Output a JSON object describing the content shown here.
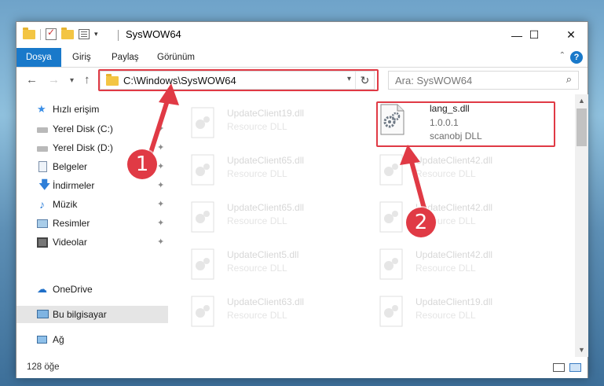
{
  "window": {
    "title": "SysWOW64",
    "controls": {
      "minimize": "—",
      "maximize": "☐",
      "close": "✕"
    }
  },
  "ribbon": {
    "tabs": [
      "Dosya",
      "Giriş",
      "Paylaş",
      "Görünüm"
    ],
    "help": "?",
    "collapse": "⌃"
  },
  "nav": {
    "back": "←",
    "forward": "→",
    "recent": "▾",
    "up": "↑",
    "address": "C:\\Windows\\SysWOW64",
    "address_dropdown": "▾",
    "refresh": "↻",
    "search_placeholder": "Ara: SysWOW64",
    "search_icon": "⌕"
  },
  "sidebar": {
    "quick_access": "Hızlı erişim",
    "items": [
      {
        "label": "Yerel Disk (C:)",
        "icon": "drive-icon",
        "pinned": true
      },
      {
        "label": "Yerel Disk (D:)",
        "icon": "drive-icon",
        "pinned": true
      },
      {
        "label": "Belgeler",
        "icon": "documents-icon",
        "pinned": true
      },
      {
        "label": "İndirmeler",
        "icon": "download-icon",
        "pinned": true
      },
      {
        "label": "Müzik",
        "icon": "music-icon",
        "pinned": true
      },
      {
        "label": "Resimler",
        "icon": "pictures-icon",
        "pinned": true
      },
      {
        "label": "Videolar",
        "icon": "video-icon",
        "pinned": true
      }
    ],
    "onedrive": "OneDrive",
    "this_pc": "Bu bilgisayar",
    "network": "Ağ",
    "pin_glyph": "📌"
  },
  "files": {
    "highlighted": {
      "name": "lang_s.dll",
      "version": "1.0.0.1",
      "description": "scanobj DLL"
    },
    "left_column": [
      {
        "name": "UpdateClient19.dll",
        "description": "Resource DLL"
      },
      {
        "name": "UpdateClient65.dll",
        "description": "Resource DLL"
      },
      {
        "name": "UpdateClient65.dll",
        "description": "Resource DLL"
      },
      {
        "name": "UpdateClient5.dll",
        "description": "Resource DLL"
      },
      {
        "name": "UpdateClient63.dll",
        "description": "Resource DLL"
      }
    ],
    "right_column": [
      {
        "name": "UpdateClient42.dll",
        "description": "Resource DLL"
      },
      {
        "name": "UpdateClient42.dll",
        "description": "Resource DLL"
      },
      {
        "name": "UpdateClient42.dll",
        "description": "Resource DLL"
      },
      {
        "name": "UpdateClient19.dll",
        "description": "Resource DLL"
      }
    ]
  },
  "status": {
    "item_count": "128 öğe"
  },
  "annotations": {
    "step1": "1",
    "step2": "2",
    "color": "#e03a45"
  }
}
